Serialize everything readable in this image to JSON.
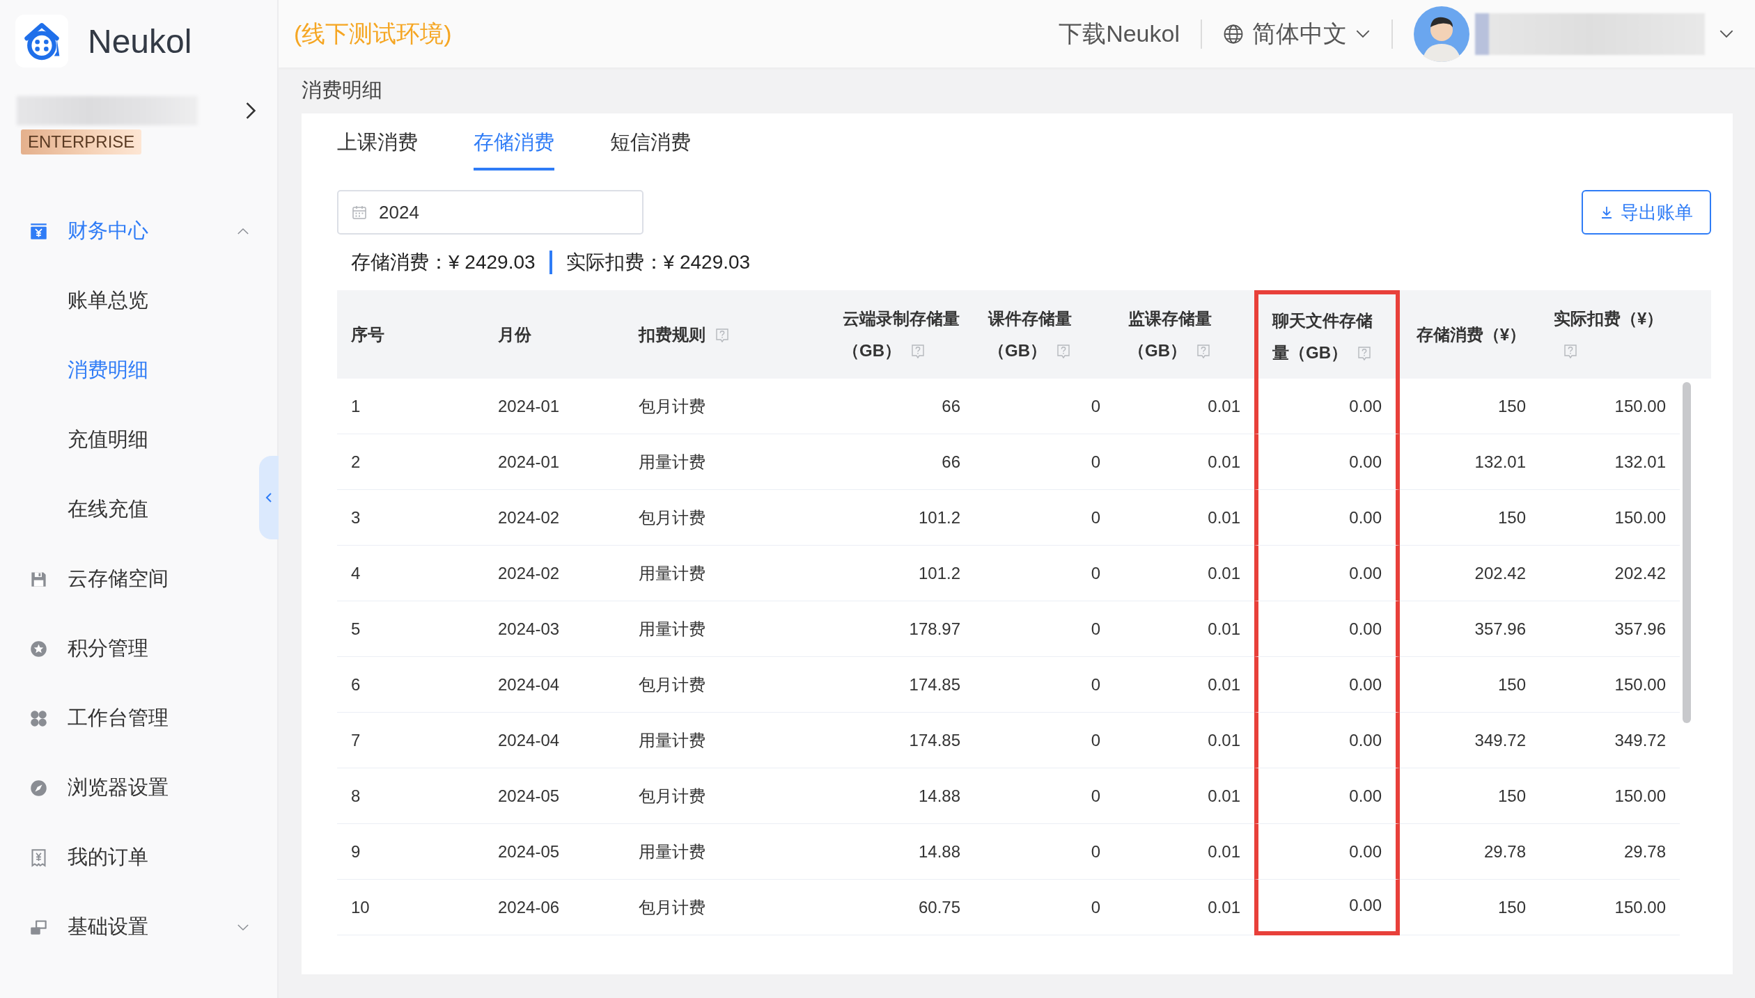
{
  "app": {
    "name": "Neukol",
    "environment": "(线下测试环境)"
  },
  "org": {
    "badge": "ENTERPRISE"
  },
  "topbar": {
    "download": "下载Neukol",
    "language": "简体中文"
  },
  "sidebar": {
    "items": [
      {
        "label": "财务中心",
        "kind": "group",
        "expanded": true,
        "children": [
          {
            "label": "账单总览",
            "selected": false
          },
          {
            "label": "消费明细",
            "selected": true
          },
          {
            "label": "充值明细",
            "selected": false
          },
          {
            "label": "在线充值",
            "selected": false
          }
        ]
      },
      {
        "label": "云存储空间",
        "kind": "link"
      },
      {
        "label": "积分管理",
        "kind": "link"
      },
      {
        "label": "工作台管理",
        "kind": "link"
      },
      {
        "label": "浏览器设置",
        "kind": "link"
      },
      {
        "label": "我的订单",
        "kind": "link"
      },
      {
        "label": "基础设置",
        "kind": "group",
        "expanded": false
      }
    ]
  },
  "breadcrumb": "消费明细",
  "tabs": [
    {
      "label": "上课消费",
      "selected": false
    },
    {
      "label": "存储消费",
      "selected": true
    },
    {
      "label": "短信消费",
      "selected": false
    }
  ],
  "filter": {
    "year": "2024"
  },
  "export_button": "导出账单",
  "summary": [
    "存储消费：¥ 2429.03",
    "实际扣费：¥ 2429.03"
  ],
  "table": {
    "columns": [
      {
        "label": "序号",
        "help": false,
        "highlighted": false
      },
      {
        "label": "月份",
        "help": false,
        "highlighted": false
      },
      {
        "label": "扣费规则",
        "help": true,
        "highlighted": false
      },
      {
        "label": "云端录制存储量（GB）",
        "help": true,
        "highlighted": false
      },
      {
        "label": "课件存储量（GB）",
        "help": true,
        "highlighted": false
      },
      {
        "label": "监课存储量（GB）",
        "help": true,
        "highlighted": false
      },
      {
        "label": "聊天文件存储量（GB）",
        "help": true,
        "highlighted": true
      },
      {
        "label": "存储消费（¥）",
        "help": false,
        "highlighted": false
      },
      {
        "label": "实际扣费（¥）",
        "help": true,
        "highlighted": false
      }
    ],
    "rows": [
      [
        "1",
        "2024-01",
        "包月计费",
        "66",
        "0",
        "0.01",
        "0.00",
        "150",
        "150.00"
      ],
      [
        "2",
        "2024-01",
        "用量计费",
        "66",
        "0",
        "0.01",
        "0.00",
        "132.01",
        "132.01"
      ],
      [
        "3",
        "2024-02",
        "包月计费",
        "101.2",
        "0",
        "0.01",
        "0.00",
        "150",
        "150.00"
      ],
      [
        "4",
        "2024-02",
        "用量计费",
        "101.2",
        "0",
        "0.01",
        "0.00",
        "202.42",
        "202.42"
      ],
      [
        "5",
        "2024-03",
        "用量计费",
        "178.97",
        "0",
        "0.01",
        "0.00",
        "357.96",
        "357.96"
      ],
      [
        "6",
        "2024-04",
        "包月计费",
        "174.85",
        "0",
        "0.01",
        "0.00",
        "150",
        "150.00"
      ],
      [
        "7",
        "2024-04",
        "用量计费",
        "174.85",
        "0",
        "0.01",
        "0.00",
        "349.72",
        "349.72"
      ],
      [
        "8",
        "2024-05",
        "包月计费",
        "14.88",
        "0",
        "0.01",
        "0.00",
        "150",
        "150.00"
      ],
      [
        "9",
        "2024-05",
        "用量计费",
        "14.88",
        "0",
        "0.01",
        "0.00",
        "29.78",
        "29.78"
      ],
      [
        "10",
        "2024-06",
        "包月计费",
        "60.75",
        "0",
        "0.01",
        "0.00",
        "150",
        "150.00"
      ]
    ]
  }
}
